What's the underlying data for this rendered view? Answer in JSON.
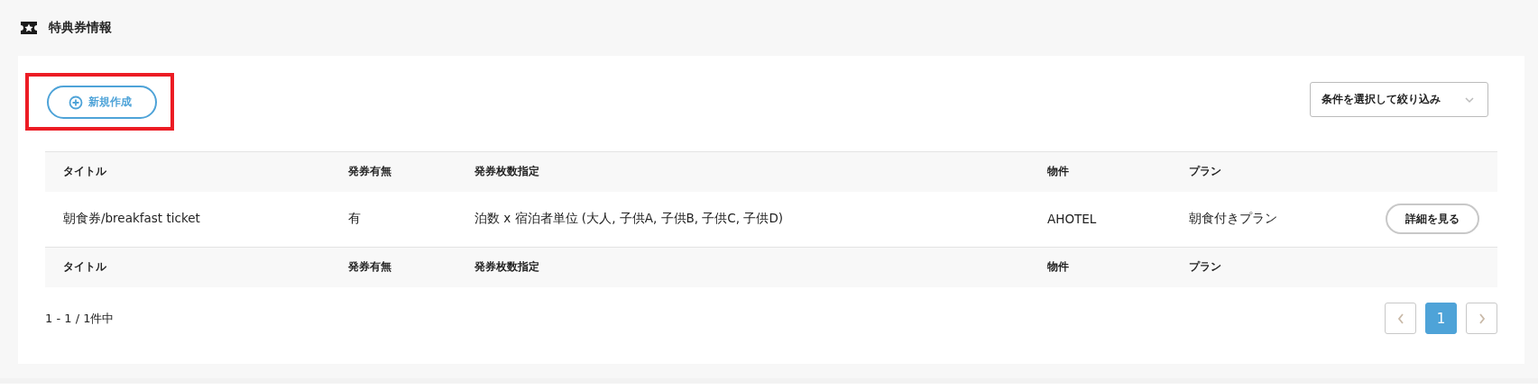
{
  "page_title": "特典券情報",
  "create_button": {
    "label": "新規作成",
    "highlighted": true
  },
  "filter": {
    "placeholder": "条件を選択して絞り込み"
  },
  "table": {
    "columns": [
      "タイトル",
      "発券有無",
      "発券枚数指定",
      "物件",
      "プラン"
    ],
    "footer_columns": [
      "タイトル",
      "発券有無",
      "発券枚数指定",
      "物件",
      "プラン"
    ],
    "rows": [
      {
        "cells": [
          "朝食券/breakfast ticket",
          "有",
          "泊数 x 宿泊者単位 (大人, 子供A, 子供B, 子供C, 子供D)",
          "AHOTEL",
          "朝食付きプラン"
        ],
        "action": "詳細を見る"
      }
    ]
  },
  "pagination": {
    "summary": "1 - 1 / 1件中",
    "pages": [
      {
        "label": "1",
        "selected": true
      }
    ]
  }
}
